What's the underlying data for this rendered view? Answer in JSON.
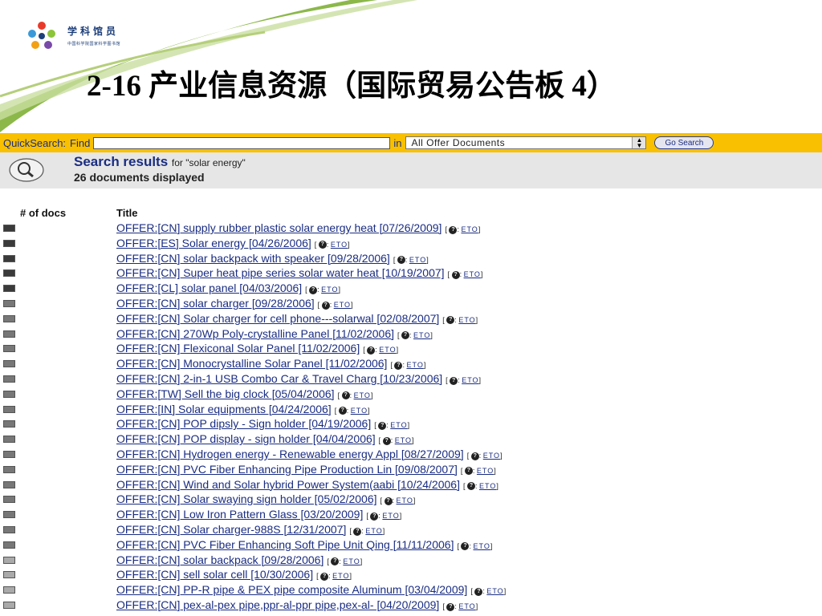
{
  "logo": {
    "cn": "学科馆员",
    "sub": "中国科学院国家科学图书馆"
  },
  "slide_title": "2-16 产业信息资源（国际贸易公告板 4）",
  "quicksearch": {
    "label": "QuickSearch:",
    "find_label": "Find",
    "input_value": "",
    "in_label": "in",
    "select_value": "All Offer Documents",
    "button": "Go Search"
  },
  "results_header": {
    "title": "Search results",
    "query": "for \"solar energy\"",
    "count": "26 documents displayed"
  },
  "columns": {
    "docs": "# of docs",
    "title": "Title"
  },
  "rows": [
    {
      "title": "OFFER:[CN] supply rubber plastic solar energy heat [07/26/2009]",
      "shade": "dark"
    },
    {
      "title": "OFFER:[ES] Solar energy [04/26/2006]",
      "shade": "dark"
    },
    {
      "title": "OFFER:[CN] solar backpack with speaker [09/28/2006]",
      "shade": "dark"
    },
    {
      "title": "OFFER:[CN] Super heat pipe series solar water heat [10/19/2007]",
      "shade": "dark"
    },
    {
      "title": "OFFER:[CL] solar panel [04/03/2006]",
      "shade": "dark"
    },
    {
      "title": "OFFER:[CN] solar charger [09/28/2006]",
      "shade": "mid"
    },
    {
      "title": "OFFER:[CN] Solar charger for cell phone---solarwal [02/08/2007]",
      "shade": "mid"
    },
    {
      "title": "OFFER:[CN] 270Wp Poly-crystalline Panel [11/02/2006]",
      "shade": "mid"
    },
    {
      "title": "OFFER:[CN] Flexiconal Solar Panel [11/02/2006]",
      "shade": "mid"
    },
    {
      "title": "OFFER:[CN] Monocrystalline Solar Panel [11/02/2006]",
      "shade": "mid"
    },
    {
      "title": "OFFER:[CN] 2-in-1 USB Combo Car & Travel Charg [10/23/2006]",
      "shade": "mid"
    },
    {
      "title": "OFFER:[TW] Sell the big clock [05/04/2006]",
      "shade": "mid"
    },
    {
      "title": "OFFER:[IN] Solar equipments [04/24/2006]",
      "shade": "mid"
    },
    {
      "title": "OFFER:[CN] POP dipsly - Sign holder [04/19/2006]",
      "shade": "mid"
    },
    {
      "title": "OFFER:[CN] POP display - sign holder [04/04/2006]",
      "shade": "mid"
    },
    {
      "title": "OFFER:[CN] Hydrogen energy - Renewable energy Appl [08/27/2009]",
      "shade": "mid"
    },
    {
      "title": "OFFER:[CN] PVC Fiber Enhancing Pipe Production Lin [09/08/2007]",
      "shade": "mid"
    },
    {
      "title": "OFFER:[CN] Wind and Solar hybrid Power System(aabi [10/24/2006]",
      "shade": "mid"
    },
    {
      "title": "OFFER:[CN] Solar swaying sign holder [05/02/2006]",
      "shade": "mid"
    },
    {
      "title": "OFFER:[CN] Low Iron Pattern Glass [03/20/2009]",
      "shade": "mid"
    },
    {
      "title": "OFFER:[CN] Solar charger-988S [12/31/2007]",
      "shade": "mid"
    },
    {
      "title": "OFFER:[CN] PVC Fiber Enhancing Soft Pipe Unit Qing [11/11/2006]",
      "shade": "mid"
    },
    {
      "title": "OFFER:[CN] solar backpack [09/28/2006]",
      "shade": "light"
    },
    {
      "title": "OFFER:[CN] sell solar cell [10/30/2006]",
      "shade": "light"
    },
    {
      "title": "OFFER:[CN] PP-R pipe & PEX pipe composite Aluminum [03/04/2009]",
      "shade": "light"
    },
    {
      "title": "OFFER:[CN] pex-al-pex pipe,ppr-al-ppr pipe,pex-al- [04/20/2009]",
      "shade": "light"
    }
  ],
  "row_tag": {
    "open": "[",
    "sep": ":",
    "eto": "ETO",
    "close": "]"
  },
  "colors": {
    "accent_bar": "#f8c000",
    "link": "#1a2d82",
    "header_bg": "#e6e6e6"
  }
}
